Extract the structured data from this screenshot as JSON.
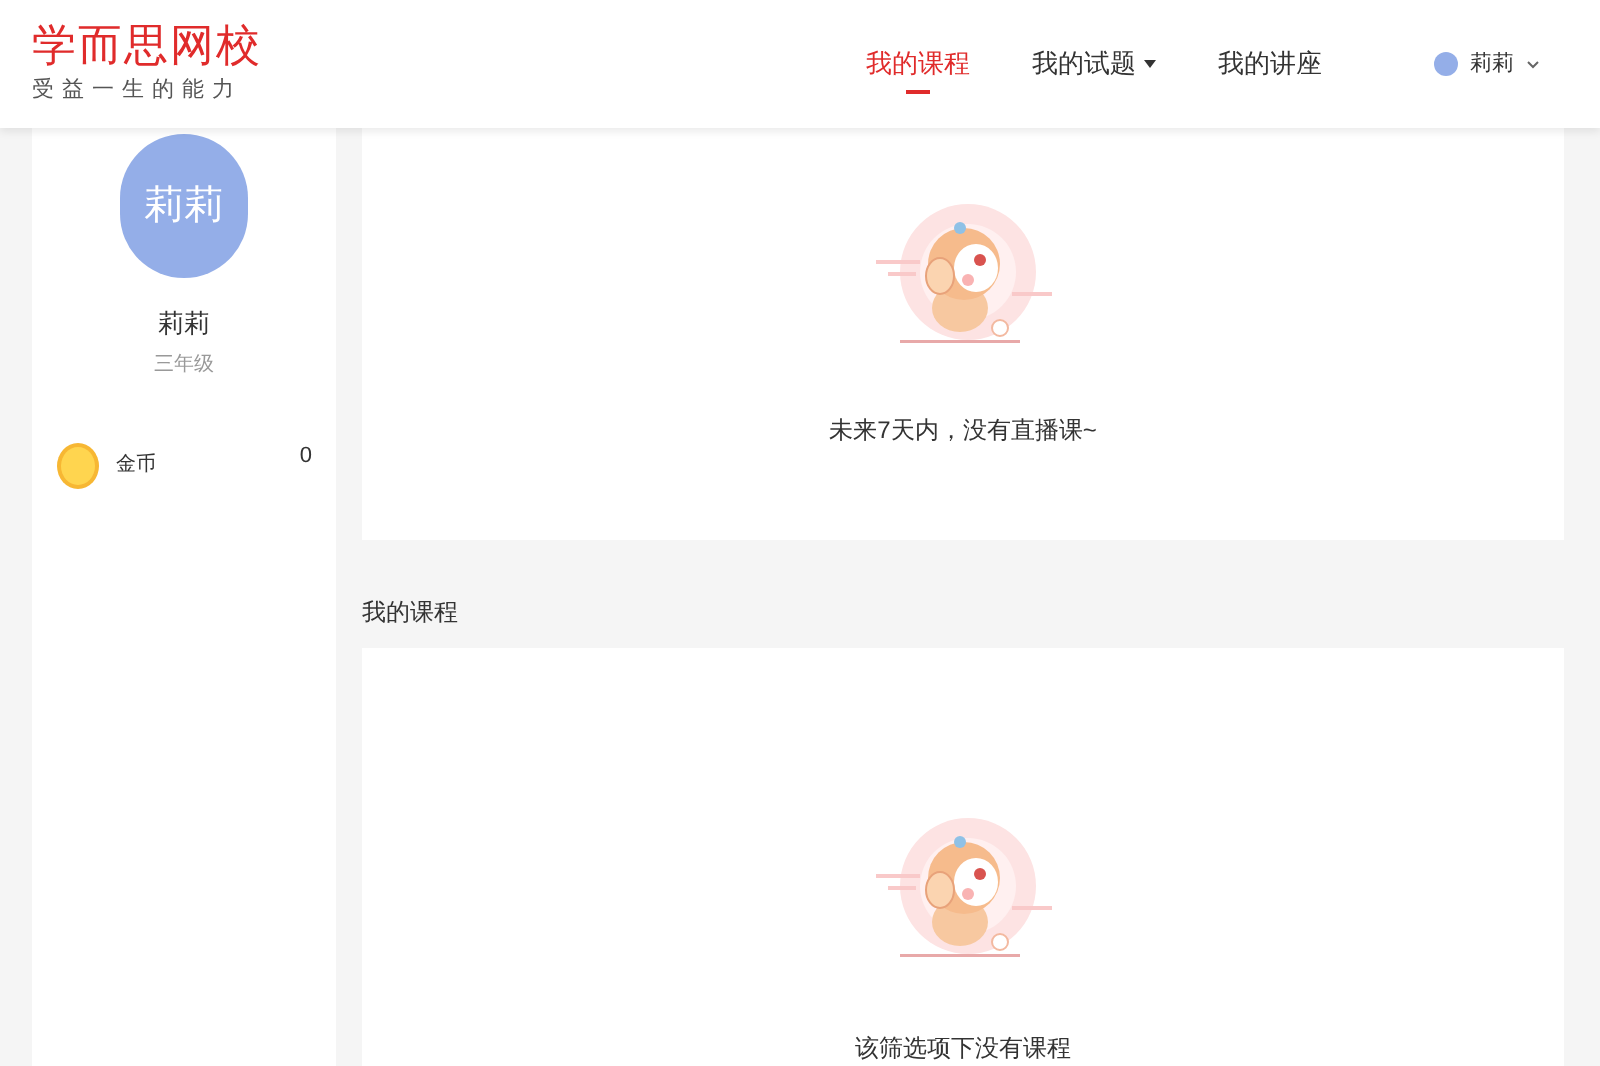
{
  "logo": {
    "title": "学而思网校",
    "slogan": "受益一生的能力"
  },
  "nav": {
    "items": [
      {
        "label": "我的课程",
        "selected": true,
        "dropdown": false
      },
      {
        "label": "我的试题",
        "selected": false,
        "dropdown": true
      },
      {
        "label": "我的讲座",
        "selected": false,
        "dropdown": false
      }
    ],
    "user": {
      "name": "莉莉"
    }
  },
  "profile": {
    "avatar_text": "莉莉",
    "name": "莉莉",
    "grade": "三年级",
    "coins": {
      "label": "金币",
      "value": "0"
    }
  },
  "live_panel": {
    "empty_message": "未来7天内，没有直播课~"
  },
  "courses": {
    "heading": "我的课程",
    "empty_message": "该筛选项下没有课程"
  }
}
